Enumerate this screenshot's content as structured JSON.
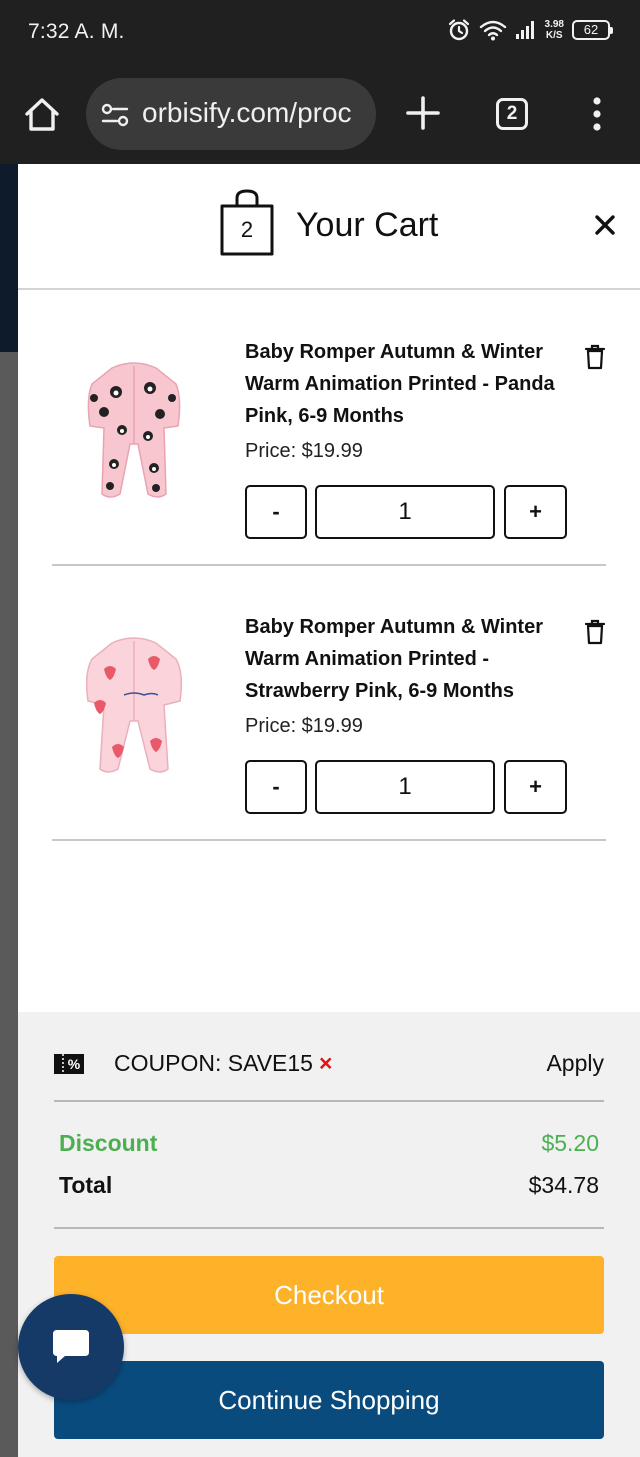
{
  "status_bar": {
    "time": "7:32 A. M.",
    "net_speed_value": "3.98",
    "net_speed_unit": "K/S",
    "battery": "62",
    "icons": [
      "alarm-icon",
      "wifi-icon",
      "signal-icon",
      "battery-icon"
    ]
  },
  "browser": {
    "url": "orbisify.com/proc",
    "tab_count": "2",
    "icons": [
      "home-icon",
      "site-settings-icon",
      "new-tab-icon",
      "tab-switcher-icon",
      "menu-icon"
    ]
  },
  "cart": {
    "title": "Your Cart",
    "count": "2",
    "items": [
      {
        "name": "Baby Romper Autumn & Winter Warm Animation Printed - Panda Pink, 6-9 Months",
        "price_label": "Price: $19.99",
        "quantity": "1",
        "minus": "-",
        "plus": "+",
        "image": "pink-panda-romper",
        "print": "panda"
      },
      {
        "name": "Baby Romper Autumn & Winter Warm Animation Printed - Strawberry Pink, 6-9 Months",
        "price_label": "Price: $19.99",
        "quantity": "1",
        "minus": "-",
        "plus": "+",
        "image": "pink-strawberry-romper",
        "print": "strawberry"
      }
    ]
  },
  "summary": {
    "coupon_label": "COUPON: SAVE15",
    "coupon_remove": "×",
    "apply": "Apply",
    "discount_label": "Discount",
    "discount_value": "$5.20",
    "total_label": "Total",
    "total_value": "$34.78",
    "checkout": "Checkout",
    "continue": "Continue Shopping"
  },
  "colors": {
    "accent_checkout": "#fdb22a",
    "accent_continue": "#0a4b7e",
    "discount_green": "#4caf50",
    "remove_red": "#e01414",
    "chat_bubble": "#163a68"
  }
}
